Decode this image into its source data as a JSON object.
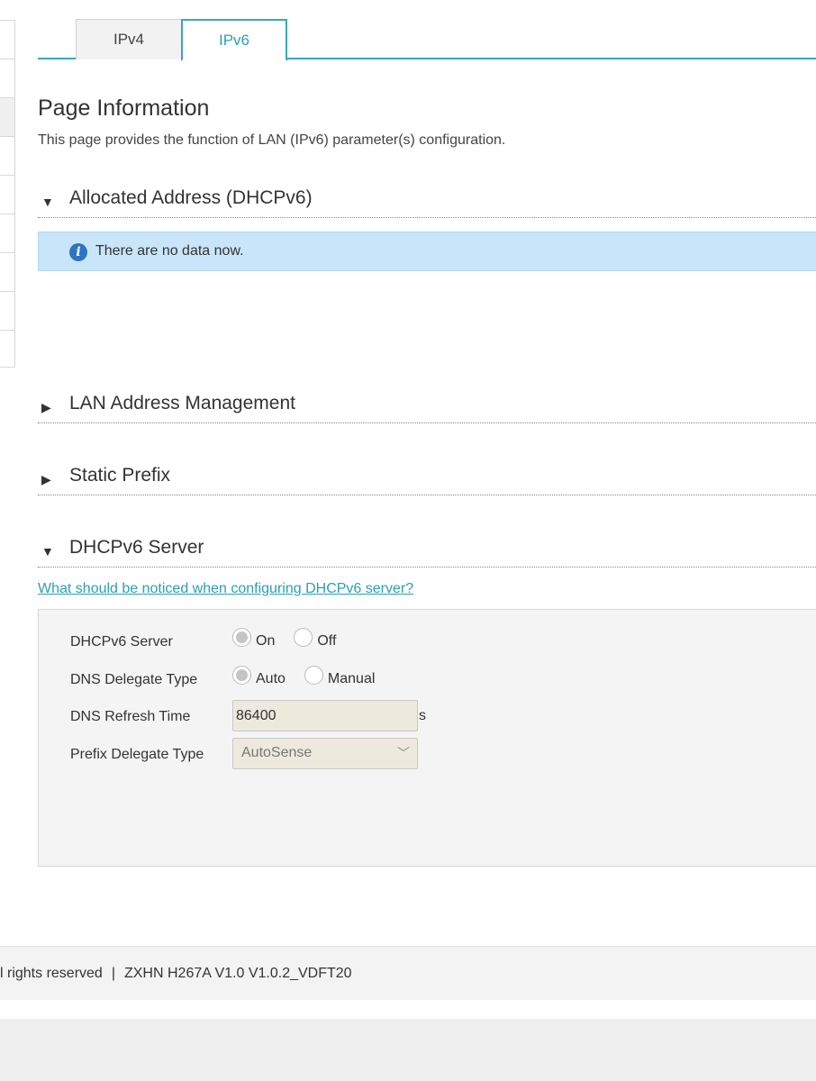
{
  "tabs": [
    {
      "label": "IPv4",
      "active": false
    },
    {
      "label": "IPv6",
      "active": true
    }
  ],
  "page": {
    "title": "Page Information",
    "description": "This page provides the function of LAN (IPv6) parameter(s) configuration."
  },
  "sections": {
    "allocated": {
      "title": "Allocated Address (DHCPv6)",
      "expanded": true,
      "arrow": "▼"
    },
    "lan_address": {
      "title": "LAN Address Management",
      "expanded": false,
      "arrow": "▶"
    },
    "static_prefix": {
      "title": "Static Prefix",
      "expanded": false,
      "arrow": "▶"
    },
    "dhcpv6_server": {
      "title": "DHCPv6 Server",
      "expanded": true,
      "arrow": "▼"
    }
  },
  "info": {
    "icon": "info-icon",
    "text": "There are no data now.",
    "icon_color": "#2f74c0"
  },
  "help_link": "What should be noticed when configuring DHCPv6 server?",
  "form": {
    "dhcpv6_server": {
      "label": "DHCPv6 Server",
      "options": [
        "On",
        "Off"
      ],
      "selected": "On"
    },
    "dns_delegate_type": {
      "label": "DNS Delegate Type",
      "options": [
        "Auto",
        "Manual"
      ],
      "selected": "Auto"
    },
    "dns_refresh_time": {
      "label": "DNS Refresh Time",
      "value": "86400",
      "unit": "s"
    },
    "prefix_delegate_type": {
      "label": "Prefix Delegate Type",
      "value": "AutoSense"
    }
  },
  "footer": {
    "rights": "l rights reserved",
    "separator": "|",
    "version": "ZXHN H267A V1.0 V1.0.2_VDFT20"
  },
  "colors": {
    "accent": "#2a9fb3",
    "info_bg": "#c8e5fa"
  }
}
